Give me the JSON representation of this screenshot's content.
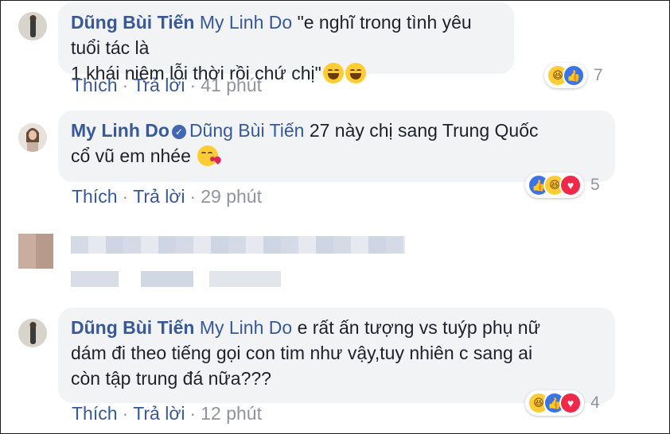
{
  "comments": [
    {
      "author": "Dũng Bùi Tiến",
      "mention": "My Linh Do",
      "text_line1": "\"e nghĩ trong tình yêu tuổi tác là",
      "text_line2": "1 khái niệm lỗi thời rồi chứ chị\"",
      "like": "Thích",
      "reply": "Trả lời",
      "time": "41 phút",
      "reactions": [
        "haha-icon",
        "like-icon"
      ],
      "reaction_count": "7"
    },
    {
      "author": "My Linh Do",
      "verified": true,
      "mention": "Dũng Bùi Tiến",
      "text_line1": "27 này chị sang Trung Quốc",
      "text_line2": "cổ vũ em nhée",
      "like": "Thích",
      "reply": "Trả lời",
      "time": "29 phút",
      "reactions": [
        "like-icon",
        "haha-icon",
        "love-icon"
      ],
      "reaction_count": "5"
    },
    {
      "author": "Dũng Bùi Tiến",
      "mention": "My Linh Do",
      "text_line1": "e rất ấn tượng vs tuýp phụ nữ",
      "text_line2": "dám đi theo tiếng gọi con tim như vậy,tuy nhiên c sang ai",
      "text_line3": "còn tập trung đá nữa???",
      "like": "Thích",
      "reply": "Trả lời",
      "time": "12 phút",
      "reactions": [
        "haha-icon",
        "like-icon",
        "love-icon"
      ],
      "reaction_count": "4"
    }
  ],
  "colors": {
    "link": "#385898",
    "meta": "#90949c",
    "bubble": "#f2f3f5",
    "like": "#3b74e8",
    "love": "#f0284a",
    "haha": "#ffcc33"
  }
}
